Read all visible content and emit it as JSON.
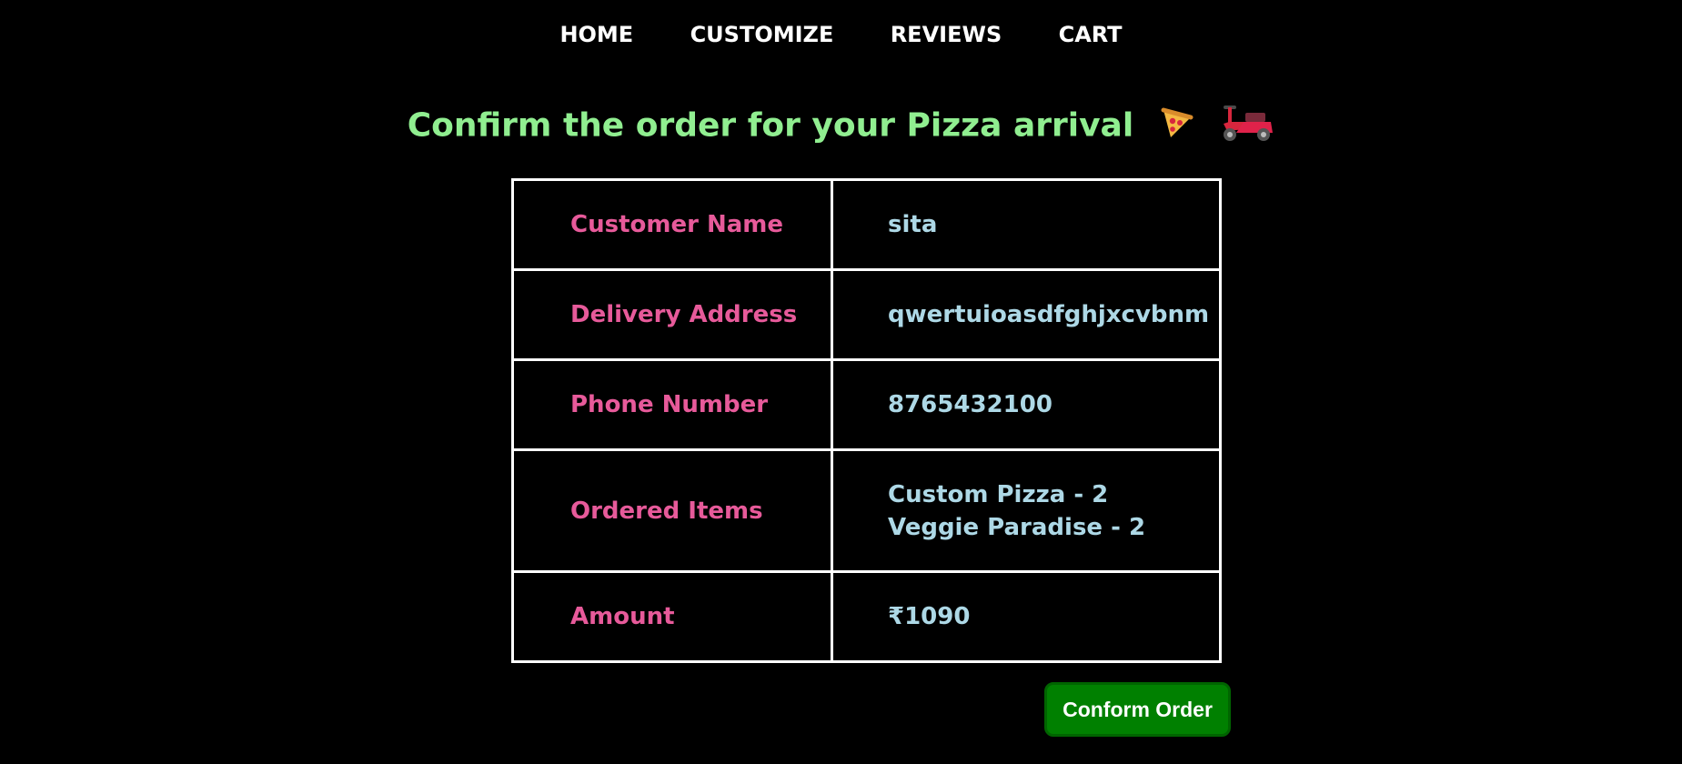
{
  "nav": {
    "items": [
      {
        "label": "HOME"
      },
      {
        "label": "CUSTOMIZE"
      },
      {
        "label": "REVIEWS"
      },
      {
        "label": "CART"
      }
    ]
  },
  "header": {
    "title": "Confirm the order for your Pizza arrival",
    "icons": [
      "pizza-icon",
      "scooter-icon"
    ]
  },
  "order": {
    "rows": [
      {
        "label": "Customer Name",
        "value": "sita"
      },
      {
        "label": "Delivery Address",
        "value": "qwertuioasdfghjxcvbnm"
      },
      {
        "label": "Phone Number",
        "value": "8765432100"
      },
      {
        "label": "Ordered Items",
        "items": [
          "Custom Pizza - 2",
          "Veggie Paradise - 2"
        ]
      },
      {
        "label": "Amount",
        "value": "₹1090"
      }
    ]
  },
  "actions": {
    "confirm_label": "Conform Order"
  },
  "colors": {
    "background": "#000000",
    "nav_text": "#ffffff",
    "title": "#90ee90",
    "label": "#e75a9a",
    "value": "#add8e6",
    "button_bg": "#008000"
  }
}
